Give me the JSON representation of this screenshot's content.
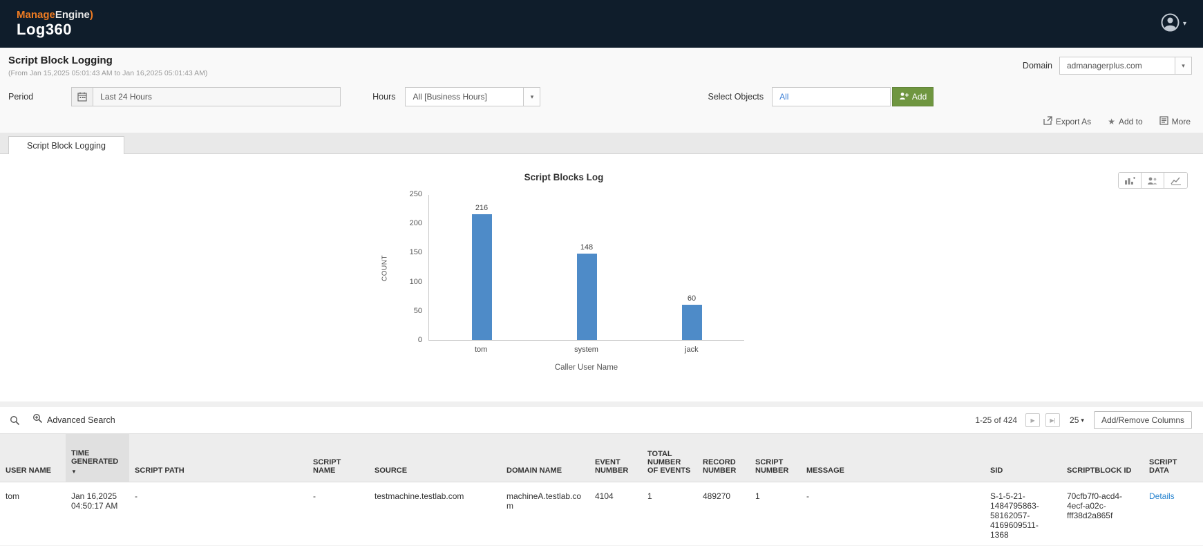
{
  "brand": {
    "manage": "Manage",
    "engine": "Engine",
    "product": "Log360"
  },
  "page": {
    "title": "Script Block Logging",
    "subtitle": "(From Jan 15,2025 05:01:43 AM to Jan 16,2025 05:01:43 AM)",
    "domain_label": "Domain",
    "domain_value": "admanagerplus.com"
  },
  "filters": {
    "period_label": "Period",
    "period_value": "Last 24 Hours",
    "hours_label": "Hours",
    "hours_value": "All [Business Hours]",
    "select_objects_label": "Select Objects",
    "select_objects_value": "All",
    "add_button": "Add"
  },
  "actions": {
    "export_as": "Export As",
    "add_to": "Add to",
    "more": "More"
  },
  "tab": {
    "label": "Script Block Logging"
  },
  "chart_data": {
    "type": "bar",
    "title": "Script Blocks Log",
    "categories": [
      "tom",
      "system",
      "jack"
    ],
    "values": [
      216,
      148,
      60
    ],
    "xlabel": "Caller User Name",
    "ylabel": "COUNT",
    "ylim": [
      0,
      250
    ],
    "yticks": [
      0,
      50,
      100,
      150,
      200,
      250
    ],
    "bar_color": "#4e8bc8",
    "legend": "none",
    "grid": false
  },
  "table_toolbar": {
    "advanced_search": "Advanced Search",
    "pagination": "1-25 of 424",
    "page_size": "25",
    "add_remove_columns": "Add/Remove Columns"
  },
  "table": {
    "columns": [
      "USER NAME",
      "TIME GENERATED",
      "SCRIPT PATH",
      "SCRIPT NAME",
      "SOURCE",
      "DOMAIN NAME",
      "EVENT NUMBER",
      "TOTAL NUMBER OF EVENTS",
      "RECORD NUMBER",
      "SCRIPT NUMBER",
      "MESSAGE",
      "SID",
      "SCRIPTBLOCK ID",
      "SCRIPT DATA"
    ],
    "rows": [
      {
        "user_name": "tom",
        "time_generated": "Jan 16,2025 04:50:17 AM",
        "script_path": "-",
        "script_name": "-",
        "source": "testmachine.testlab.com",
        "domain_name": "machineA.testlab.com",
        "event_number": "4104",
        "total_events": "1",
        "record_number": "489270",
        "script_number": "1",
        "message": "-",
        "sid": "S-1-5-21-1484795863-58162057-4169609511-1368",
        "scriptblock_id": "70cfb7f0-acd4-4ecf-a02c-fff38d2a865f",
        "script_data": "Details"
      }
    ]
  },
  "icons": {
    "caret_down": "▾",
    "sort_desc": "▼",
    "star": "★",
    "next": "▶",
    "last": "▶|"
  },
  "colors": {
    "topbar": "#0f1d2b",
    "accent_orange": "#ee7b22",
    "bar": "#4e8bc8",
    "add_green": "#6f9640",
    "link_blue": "#2a85d0"
  }
}
